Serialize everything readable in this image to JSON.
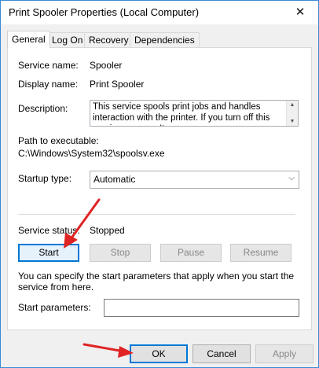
{
  "window": {
    "title": "Print Spooler Properties (Local Computer)"
  },
  "tabs": [
    {
      "label": "General",
      "active": true
    },
    {
      "label": "Log On",
      "active": false
    },
    {
      "label": "Recovery",
      "active": false
    },
    {
      "label": "Dependencies",
      "active": false
    }
  ],
  "general": {
    "service_name_label": "Service name:",
    "service_name": "Spooler",
    "display_name_label": "Display name:",
    "display_name": "Print Spooler",
    "description_label": "Description:",
    "description": "This service spools print jobs and handles interaction with the printer.  If you turn off this service, you won't",
    "path_label": "Path to executable:",
    "path": "C:\\Windows\\System32\\spoolsv.exe",
    "startup_type_label": "Startup type:",
    "startup_type": "Automatic",
    "status_label": "Service status:",
    "status": "Stopped",
    "buttons": {
      "start": "Start",
      "stop": "Stop",
      "pause": "Pause",
      "resume": "Resume"
    },
    "hint": "You can specify the start parameters that apply when you start the service from here.",
    "params_label": "Start parameters:",
    "params_value": ""
  },
  "footer": {
    "ok": "OK",
    "cancel": "Cancel",
    "apply": "Apply"
  },
  "colors": {
    "accent": "#0078d7",
    "annotation_arrow": "#e02424",
    "window_border": "#3a8ad6"
  },
  "icons": {
    "close": "close-icon",
    "dropdown": "chevron-down-icon",
    "scroll_up": "scroll-up-icon",
    "scroll_down": "scroll-down-icon"
  }
}
